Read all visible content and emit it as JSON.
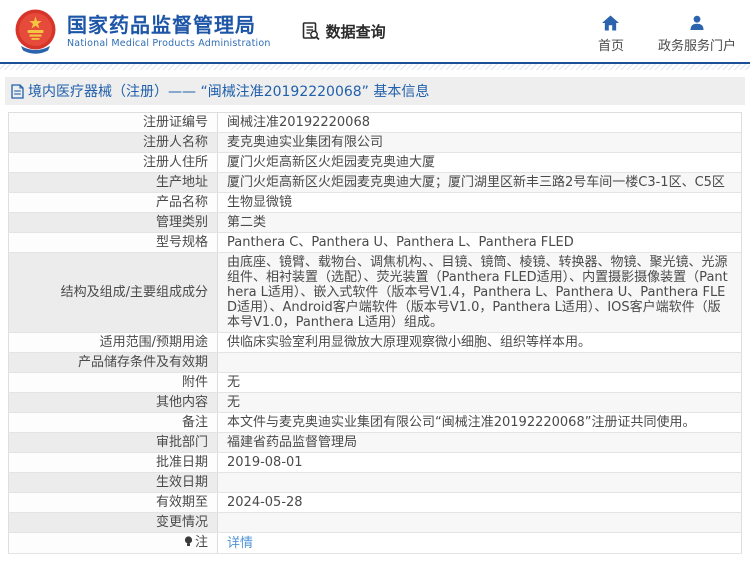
{
  "header": {
    "org_name": "国家药品监督管理局",
    "org_name_en": "National Medical Products Administration",
    "data_query_label": "数据查询",
    "nav": [
      {
        "id": "home",
        "label": "首页",
        "icon": "home-icon"
      },
      {
        "id": "gov-portal",
        "label": "政务服务门户",
        "icon": "user-icon"
      }
    ]
  },
  "page": {
    "title": "境内医疗器械（注册）—— “闽械注准20192220068” 基本信息"
  },
  "table": {
    "rows": [
      {
        "label": "注册证编号",
        "value": "闽械注准20192220068"
      },
      {
        "label": "注册人名称",
        "value": "麦克奥迪实业集团有限公司"
      },
      {
        "label": "注册人住所",
        "value": "厦门火炬高新区火炬园麦克奥迪大厦"
      },
      {
        "label": "生产地址",
        "value": "厦门火炬高新区火炬园麦克奥迪大厦；厦门湖里区新丰三路2号车间一楼C3-1区、C5区"
      },
      {
        "label": "产品名称",
        "value": "生物显微镜"
      },
      {
        "label": "管理类别",
        "value": "第二类"
      },
      {
        "label": "型号规格",
        "value": "Panthera C、Panthera U、Panthera L、Panthera FLED"
      },
      {
        "label": "结构及组成/主要组成成分",
        "value": "由底座、镜臂、载物台、调焦机构、、目镜、镜筒、棱镜、转换器、物镜、聚光镜、光源组件、相衬装置（选配）、荧光装置（Panthera FLED适用）、内置摄影摄像装置（Panthera L适用）、嵌入式软件（版本号V1.4，Panthera L、Panthera U、Panthera FLED适用）、Android客户端软件（版本号V1.0，Panthera L适用）、IOS客户端软件（版本号V1.0，Panthera L适用）组成。"
      },
      {
        "label": "适用范围/预期用途",
        "value": "供临床实验室利用显微放大原理观察微小细胞、组织等样本用。"
      },
      {
        "label": "产品储存条件及有效期",
        "value": ""
      },
      {
        "label": "附件",
        "value": "无"
      },
      {
        "label": "其他内容",
        "value": "无"
      },
      {
        "label": "备注",
        "value": "本文件与麦克奥迪实业集团有限公司“闽械注准20192220068”注册证共同使用。"
      },
      {
        "label": "审批部门",
        "value": "福建省药品监督管理局"
      },
      {
        "label": "批准日期",
        "value": "2019-08-01"
      },
      {
        "label": "生效日期",
        "value": ""
      },
      {
        "label": "有效期至",
        "value": "2024-05-28"
      },
      {
        "label": "变更情况",
        "value": ""
      },
      {
        "label": "注",
        "value": "详情",
        "type": "link",
        "icon": "bulb-icon"
      }
    ]
  },
  "colors": {
    "brand_blue": "#1d55a7",
    "nav_icon_blue": "#2b63ad",
    "divider_blue": "#1a4e96",
    "title_text_blue": "#2160ab",
    "link_blue": "#4f94d5",
    "body_text": "#4a4a4a",
    "stripe_label_bg": "#ececec",
    "stripe_value_bg": "#f7f7f7",
    "emblem_red": "#d6352a",
    "emblem_gold": "#f5c542"
  }
}
